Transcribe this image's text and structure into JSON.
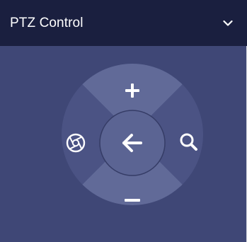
{
  "panel": {
    "title": "PTZ Control"
  },
  "icons": {
    "collapse": "chevron-down-icon",
    "up": "plus-icon",
    "down": "minus-icon",
    "left": "aperture-icon",
    "right": "zoom-icon",
    "center": "arrow-left-icon"
  },
  "colors": {
    "header_bg": "#1a1f3f",
    "panel_bg": "#3f4776",
    "ring_top_bottom": "#616a98",
    "ring_left_right": "#4b5384",
    "center_button": "#5b6493",
    "icon": "#ffffff"
  }
}
